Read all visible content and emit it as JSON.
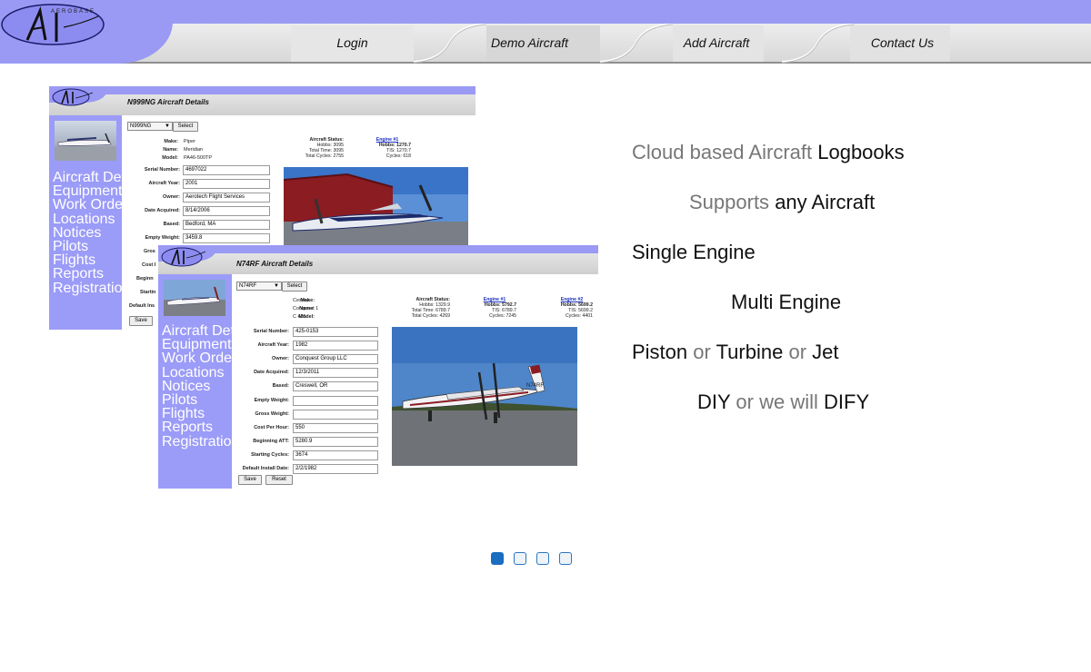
{
  "nav": {
    "items": [
      {
        "label": "Login"
      },
      {
        "label": "Demo Aircraft"
      },
      {
        "label": "Add Aircraft"
      },
      {
        "label": "Contact Us"
      }
    ],
    "logo_letters": "AI",
    "logo_word": "AEROBASE"
  },
  "shot_back": {
    "title": "N999NG Aircraft Details",
    "dropdown": "N999NG",
    "select_label": "Select",
    "save_label": "Save",
    "sidebar": [
      "Aircraft Details",
      "Equipment",
      "Work Orders",
      "Locations",
      "Notices",
      "Pilots",
      "Flights",
      "Reports",
      "Registration"
    ],
    "info": [
      {
        "label": "Make:",
        "value": "Piper"
      },
      {
        "label": "Name:",
        "value": "Meridian"
      },
      {
        "label": "Model:",
        "value": "PA46-500TP"
      }
    ],
    "fields": [
      {
        "label": "Serial Number:",
        "value": "4697022"
      },
      {
        "label": "Aircraft Year:",
        "value": "2001"
      },
      {
        "label": "Owner:",
        "value": "Aerotech Flight Services"
      },
      {
        "label": "Date Acquired:",
        "value": "8/14/2006"
      },
      {
        "label": "Based:",
        "value": "Bedford, MA"
      },
      {
        "label": "Empty Weight:",
        "value": "3459.8"
      }
    ],
    "cut_labels": [
      "Gros",
      "Cost I",
      "Beginn",
      "Startin",
      "Default Ins"
    ],
    "status": {
      "heading": "Aircraft Status:",
      "hobbs": "Hobbs: 3095",
      "total_time": "Total Time: 3095",
      "total_cycles": "Total Cycles: 2755"
    },
    "engine1": {
      "link": "Engine #1",
      "hobbs": "Hobbs: 1270.7",
      "tis": "TIS: 1270.7",
      "cycles": "Cycles: 618"
    }
  },
  "shot_front": {
    "title": "N74RF Aircraft Details",
    "dropdown": "N74RF",
    "select_label": "Select",
    "save_label": "Save",
    "reset_label": "Reset",
    "sidebar": [
      "Aircraft Details",
      "Equipment",
      "Work Orders",
      "Locations",
      "Notices",
      "Pilots",
      "Flights",
      "Reports",
      "Registration"
    ],
    "info": [
      {
        "label": "Make:",
        "value": "Cessna"
      },
      {
        "label": "Name:",
        "value": "Conquest 1"
      },
      {
        "label": "Model:",
        "value": "C 425"
      }
    ],
    "fields": [
      {
        "label": "Serial Number:",
        "value": "425-0153"
      },
      {
        "label": "Aircraft Year:",
        "value": "1982"
      },
      {
        "label": "Owner:",
        "value": "Conquest Group LLC"
      },
      {
        "label": "Date Acquired:",
        "value": "12/3/2011"
      },
      {
        "label": "Based:",
        "value": "Creswell, OR"
      },
      {
        "label": "Empty Weight:",
        "value": ""
      },
      {
        "label": "Gross Weight:",
        "value": ""
      },
      {
        "label": "Cost Per Hour:",
        "value": "550"
      },
      {
        "label": "Beginning ATT:",
        "value": "5280.9"
      },
      {
        "label": "Starting Cycles:",
        "value": "3674"
      },
      {
        "label": "Default Install Date:",
        "value": "2/2/1982"
      }
    ],
    "status": {
      "heading": "Aircraft Status:",
      "hobbs": "Hobbs: 1329.9",
      "total_time": "Total Time: 6789.7",
      "total_cycles": "Total Cycles: 4269"
    },
    "engine1": {
      "link": "Engine #1",
      "hobbs": "Hobbs: 5792.7",
      "tis": "TIS: 6789.7",
      "cycles": "Cycles: 7245"
    },
    "engine2": {
      "link": "Engine #2",
      "hobbs": "Hobbs: 5699.2",
      "tis": "TIS: 5699.2",
      "cycles": "Cycles: 4401"
    },
    "tail_number": "N74RF"
  },
  "copy": {
    "line1_a": "Cloud based Aircraft",
    "line1_b": "Logbooks",
    "line2_a": "Supports",
    "line2_b": "any Aircraft",
    "line3": "Single Engine",
    "line4": "Multi Engine",
    "line5_a": "Piston",
    "line5_b": "or",
    "line5_c": "Turbine",
    "line5_d": "or",
    "line5_e": "Jet",
    "line6_a": "DIY",
    "line6_b": "or we will",
    "line6_c": "DIFY"
  },
  "carousel": {
    "count": 4,
    "active_index": 0
  },
  "colors": {
    "brand_purple": "#9a9af4",
    "dot_active": "#1a6dbf",
    "text_grey": "#777777"
  }
}
